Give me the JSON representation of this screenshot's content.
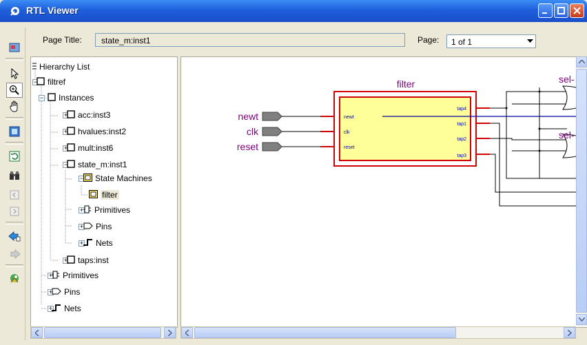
{
  "window": {
    "title": "RTL Viewer"
  },
  "toolbar": {
    "icons": [
      "export-icon",
      "pointer-icon",
      "zoom-icon",
      "hand-icon",
      "fit-window-icon",
      "refresh-icon",
      "find-icon",
      "collapse-icon",
      "expand-icon",
      "back-icon",
      "forward-icon",
      "run-icon"
    ]
  },
  "pagebar": {
    "page_title_label": "Page Title:",
    "page_title_value": "state_m:inst1",
    "page_label": "Page:",
    "page_value": "1 of 1"
  },
  "hierarchy": {
    "root_label": "Hierarchy List",
    "nodes": [
      "filtref",
      "Instances",
      "acc:inst3",
      "hvalues:inst2",
      "mult:inst6",
      "state_m:inst1",
      "State Machines",
      "filter",
      "Primitives",
      "Pins",
      "Nets",
      "taps:inst",
      "Primitives",
      "Pins",
      "Nets"
    ]
  },
  "schematic": {
    "block_name": "filter",
    "inputs": [
      "newt",
      "clk",
      "reset"
    ],
    "block_inputs": [
      "newt",
      "clk",
      "reset"
    ],
    "block_outputs": [
      "tap4",
      "tap1",
      "tap2",
      "tap3"
    ],
    "right_labels": [
      "sel-",
      "sel-"
    ]
  }
}
